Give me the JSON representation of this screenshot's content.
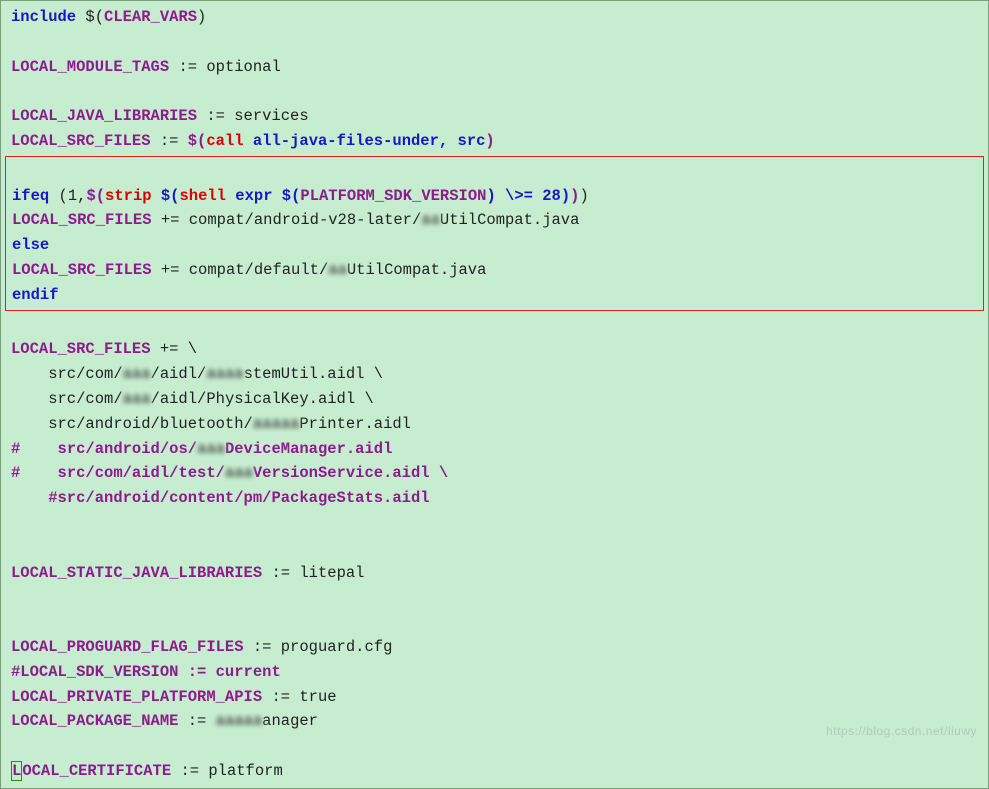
{
  "lines": {
    "l01a": "include",
    "l01b": " $(",
    "l01c": "CLEAR_VARS",
    "l01d": ")",
    "l03a": "LOCAL_MODULE_TAGS",
    "l03b": " := optional",
    "l05a": "LOCAL_JAVA_LIBRARIES",
    "l05b": " := services",
    "l06a": "LOCAL_SRC_FILES",
    "l06b": " := ",
    "l06c": "$(",
    "l06d": "call",
    "l06e": " all-java-files-under, src",
    "l06f": ")",
    "l08a": "ifeq",
    "l08b": " (1,",
    "l08c": "$(",
    "l08d": "strip",
    "l08e": " $(",
    "l08f": "shell",
    "l08g": " expr $(",
    "l08h": "PLATFORM_SDK_VERSION",
    "l08i": ") \\>= 28)",
    "l08j": ")",
    "l08k": ")",
    "l09a": "LOCAL_SRC_FILES",
    "l09b": " += compat/android-v28-later/",
    "l09c": "aa",
    "l09d": "UtilCompat.java",
    "l10a": "else",
    "l11a": "LOCAL_SRC_FILES",
    "l11b": " += compat/default/",
    "l11c": "aa",
    "l11d": "UtilCompat.java",
    "l12a": "endif",
    "l14a": "LOCAL_SRC_FILES",
    "l14b": " += \\",
    "l15a": "    src/com/",
    "l15b": "aaa",
    "l15c": "/aidl/",
    "l15d": "aaaa",
    "l15e": "stemUtil.aidl \\",
    "l16a": "    src/com/",
    "l16b": "aaa",
    "l16c": "/aidl/PhysicalKey.aidl \\",
    "l17a": "    src/android/bluetooth/",
    "l17b": "aaaaa",
    "l17c": "Printer.aidl",
    "l18a": "#",
    "l18b": "    src/android/os/",
    "l18c": "aaa",
    "l18d": "DeviceManager.aidl",
    "l19a": "#",
    "l19b": "    src/com/aidl/test/",
    "l19c": "aaa",
    "l19d": "VersionService.aidl \\",
    "l20a": "    #src/android/content/pm/PackageStats.aidl",
    "l23a": "LOCAL_STATIC_JAVA_LIBRARIES",
    "l23b": " := litepal",
    "l26a": "LOCAL_PROGUARD_FLAG_FILES",
    "l26b": " := proguard.cfg",
    "l27a": "#LOCAL_SDK_VERSION := current",
    "l28a": "LOCAL_PRIVATE_PLATFORM_APIS",
    "l28b": " := true",
    "l29a": "LOCAL_PACKAGE_NAME",
    "l29b": " := ",
    "l29c": "aaaaa",
    "l29d": "anager",
    "l31a": "L",
    "l31b": "OCAL_CERTIFICATE",
    "l31c": " := platform"
  },
  "watermark": "https://blog.csdn.net/liuwy"
}
